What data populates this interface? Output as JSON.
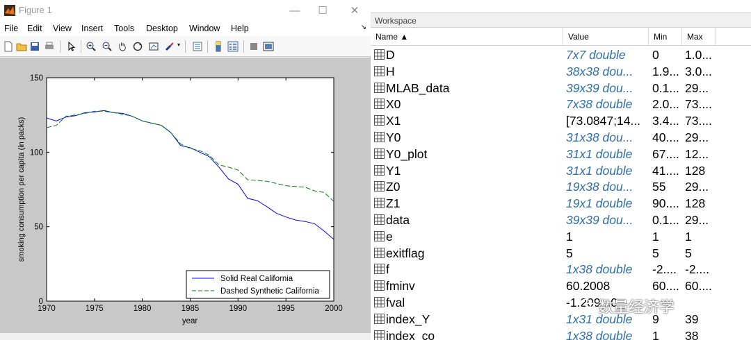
{
  "figure": {
    "title": "Figure 1",
    "menus": [
      "File",
      "Edit",
      "View",
      "Insert",
      "Tools",
      "Desktop",
      "Window",
      "Help"
    ],
    "menu_dock_glyph": "↘",
    "toolbar_icons": [
      "new-figure-icon",
      "open-file-icon",
      "save-icon",
      "print-icon",
      "pointer-icon",
      "zoom-in-icon",
      "zoom-out-icon",
      "pan-hand-icon",
      "rotate-3d-icon",
      "data-cursor-icon",
      "brush-icon",
      "link-plot-icon",
      "insert-colorbar-icon",
      "insert-legend-icon",
      "hide-plot-tools-icon",
      "show-plot-tools-icon"
    ],
    "colors": {
      "canvas_bg": "#c8c8c8",
      "axes_bg": "#ffffff",
      "solid_line": "#0000ff",
      "dashed_line": "#008000"
    }
  },
  "chart_data": {
    "type": "line",
    "title": "",
    "xlabel": "year",
    "ylabel": "smoking consumption per capita (in packs)",
    "xlim": [
      1970,
      2000
    ],
    "ylim": [
      0,
      150
    ],
    "xticks": [
      "1970",
      "1975",
      "1980",
      "1985",
      "1990",
      "1995",
      "2000"
    ],
    "yticks": [
      "0",
      "50",
      "100",
      "150"
    ],
    "grid": false,
    "legend_position": "bottom-right",
    "series": [
      {
        "name": "Solid Real California",
        "style": "solid",
        "color": "#0000ff",
        "x": [
          1970,
          1971,
          1972,
          1973,
          1974,
          1975,
          1976,
          1977,
          1978,
          1979,
          1980,
          1981,
          1982,
          1983,
          1984,
          1985,
          1986,
          1987,
          1988,
          1989,
          1990,
          1991,
          1992,
          1993,
          1994,
          1995,
          1996,
          1997,
          1998,
          1999,
          2000
        ],
        "y": [
          123,
          121,
          123.5,
          124.5,
          126.5,
          127,
          128,
          126.5,
          126,
          124,
          121,
          119.5,
          118,
          113,
          104.5,
          103,
          100,
          97,
          90,
          82,
          78.5,
          69,
          67.5,
          63.5,
          59,
          56.5,
          54.5,
          53.5,
          52,
          47,
          41.5
        ]
      },
      {
        "name": "Dashed Synthetic California",
        "style": "dashed",
        "color": "#008000",
        "x": [
          1970,
          1971,
          1972,
          1973,
          1974,
          1975,
          1976,
          1977,
          1978,
          1979,
          1980,
          1981,
          1982,
          1983,
          1984,
          1985,
          1986,
          1987,
          1988,
          1989,
          1990,
          1991,
          1992,
          1993,
          1994,
          1995,
          1996,
          1997,
          1998,
          1999,
          2000
        ],
        "y": [
          116.5,
          118,
          124,
          125,
          126,
          127.5,
          127.5,
          126.5,
          125.5,
          124,
          121,
          119.5,
          118,
          113,
          105.5,
          102.5,
          101,
          98,
          91.5,
          90,
          88,
          81.5,
          81,
          80.5,
          79,
          77.5,
          77,
          76.5,
          74,
          73,
          67
        ]
      }
    ]
  },
  "workspace": {
    "title": "Workspace",
    "columns": {
      "name": "Name ▲",
      "value": "Value",
      "min": "Min",
      "max": "Max"
    },
    "rows": [
      {
        "name": "D",
        "value": "7x7 double",
        "size": true,
        "min": "0",
        "max": "1.0..."
      },
      {
        "name": "H",
        "value": "38x38 dou...",
        "size": true,
        "min": "1.9...",
        "max": "3.0..."
      },
      {
        "name": "MLAB_data",
        "value": "39x39 dou...",
        "size": true,
        "min": "0.1...",
        "max": "29..."
      },
      {
        "name": "X0",
        "value": "7x38 double",
        "size": true,
        "min": "2.0...",
        "max": "73...."
      },
      {
        "name": "X1",
        "value": "[73.0847;14...",
        "size": false,
        "min": "3.4...",
        "max": "73...."
      },
      {
        "name": "Y0",
        "value": "31x38 dou...",
        "size": true,
        "min": "40....",
        "max": "29..."
      },
      {
        "name": "Y0_plot",
        "value": "31x1 double",
        "size": true,
        "min": "67....",
        "max": "12..."
      },
      {
        "name": "Y1",
        "value": "31x1 double",
        "size": true,
        "min": "41....",
        "max": "128"
      },
      {
        "name": "Z0",
        "value": "19x38 dou...",
        "size": true,
        "min": "55",
        "max": "29..."
      },
      {
        "name": "Z1",
        "value": "19x1 double",
        "size": true,
        "min": "90....",
        "max": "128"
      },
      {
        "name": "data",
        "value": "39x39 dou...",
        "size": true,
        "min": "0.1...",
        "max": "29..."
      },
      {
        "name": "e",
        "value": "1",
        "size": false,
        "min": "1",
        "max": "1"
      },
      {
        "name": "exitflag",
        "value": "5",
        "size": false,
        "min": "5",
        "max": "5"
      },
      {
        "name": "f",
        "value": "1x38 double",
        "size": true,
        "min": "-2....",
        "max": "-2...."
      },
      {
        "name": "fminv",
        "value": "60.2008",
        "size": false,
        "min": "60....",
        "max": "60...."
      },
      {
        "name": "fval",
        "value": "-1.209...0",
        "size": false,
        "min": "",
        "max": ""
      },
      {
        "name": "index_Y",
        "value": "1x31 double",
        "size": true,
        "min": "9",
        "max": "39"
      },
      {
        "name": "index_co",
        "value": "1x38 double",
        "size": true,
        "min": "1",
        "max": "38"
      }
    ],
    "watermark": "数量经济学"
  }
}
